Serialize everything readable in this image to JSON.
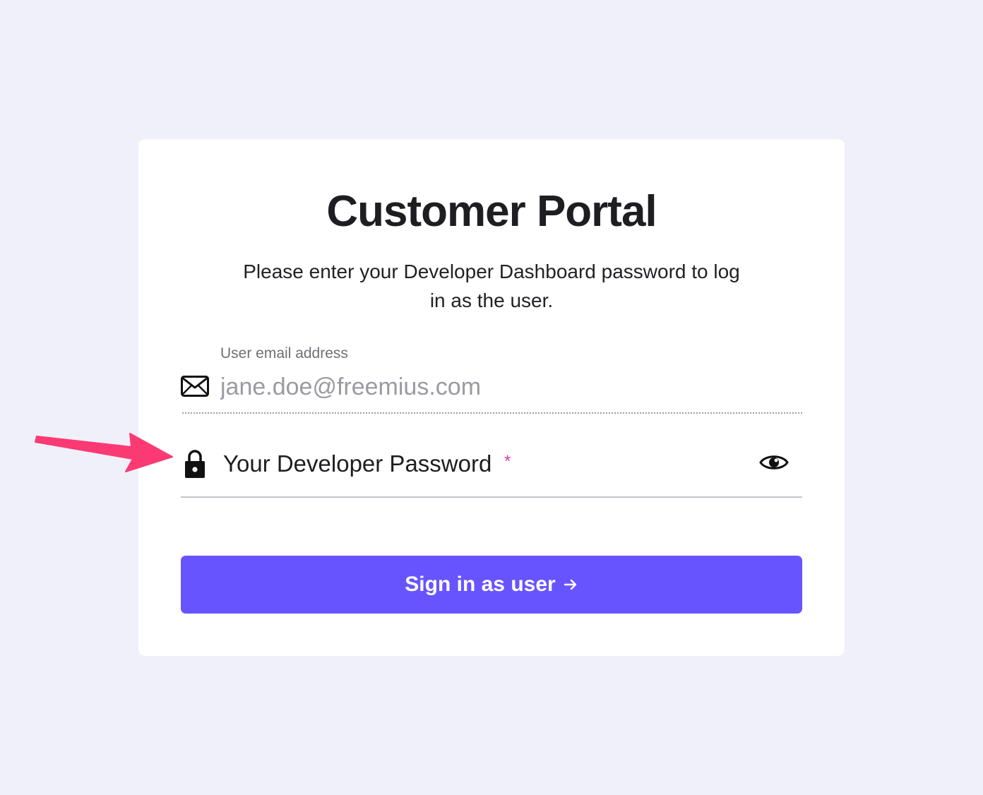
{
  "card": {
    "title": "Customer Portal",
    "subtitle": "Please enter your Developer Dashboard password to log in as the user."
  },
  "email": {
    "label": "User email address",
    "value": "jane.doe@freemius.com",
    "icon": "mail-icon"
  },
  "password": {
    "label": "Your Developer Password",
    "required_mark": "*",
    "icon": "lock-icon",
    "toggle_icon": "eye-icon"
  },
  "submit": {
    "label": "Sign in as user",
    "icon": "arrow-right-icon"
  },
  "colors": {
    "page_background": "#eff0f9",
    "card_background": "#ffffff",
    "button": "#6854ff",
    "required": "#e23bb0",
    "annotation_arrow": "#fb3a74"
  }
}
